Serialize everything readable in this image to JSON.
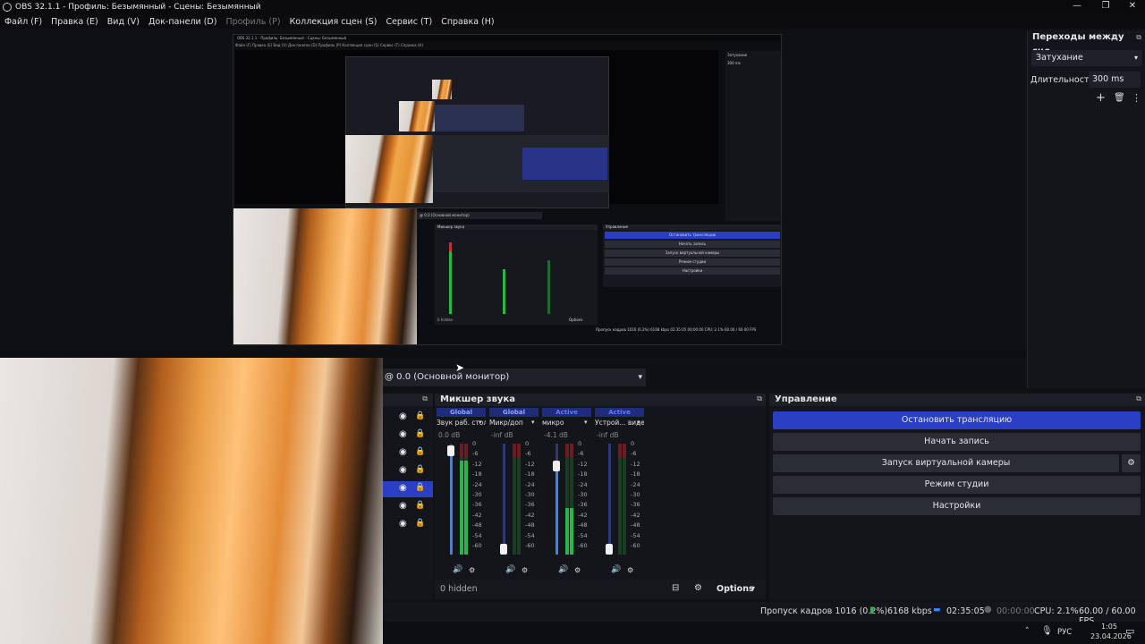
{
  "window": {
    "title": "OBS 32.1.1 - Профиль: Безымянный - Сцены: Безымянный",
    "controls": [
      "—",
      "❐",
      "✕"
    ]
  },
  "menu": [
    {
      "label": "Файл (F)",
      "disabled": false
    },
    {
      "label": "Правка (E)",
      "disabled": false
    },
    {
      "label": "Вид (V)",
      "disabled": false
    },
    {
      "label": "Док-панели (D)",
      "disabled": false
    },
    {
      "label": "Профиль (P)",
      "disabled": true
    },
    {
      "label": "Коллекция сцен (S)",
      "disabled": false
    },
    {
      "label": "Сервис (T)",
      "disabled": false
    },
    {
      "label": "Справка (H)",
      "disabled": false
    }
  ],
  "transitions": {
    "title": "Переходы между сце...",
    "selected": "Затухание",
    "duration_label": "Длительность",
    "duration_value": "300 ms"
  },
  "monitor": {
    "selected": "@ 0.0 (Основной монитор)"
  },
  "mixer": {
    "title": "Микшер звука",
    "hidden_label": "0 hidden",
    "options_label": "Options",
    "channels": [
      {
        "scope": "Global",
        "name": "Звук раб. стола",
        "db": "0.0 dB",
        "fader": 0.98,
        "level": 0.85
      },
      {
        "scope": "Global",
        "name": "Микр/доп",
        "db": "-inf dB",
        "fader": 0.02,
        "level": 0.0
      },
      {
        "scope": "Active",
        "name": "микро",
        "db": "-4.1 dB",
        "fader": 0.85,
        "level": 0.42
      },
      {
        "scope": "Active",
        "name": "Устрой... видео",
        "db": "-inf dB",
        "fader": 0.02,
        "level": 0.0
      }
    ],
    "scale": [
      "0",
      "-6",
      "-12",
      "-18",
      "-24",
      "-30",
      "-36",
      "-42",
      "-48",
      "-54",
      "-60"
    ]
  },
  "sources": {
    "rows": 7,
    "selected_index": 4
  },
  "controls": {
    "title": "Управление",
    "buttons": [
      {
        "label": "Остановить трансляцию",
        "primary": true
      },
      {
        "label": "Начать запись",
        "primary": false
      },
      {
        "label": "Запуск виртуальной камеры",
        "primary": false
      },
      {
        "label": "Режим студии",
        "primary": false
      },
      {
        "label": "Настройки",
        "primary": false
      }
    ]
  },
  "status": {
    "dropped_frames": "Пропуск кадров 1016 (0.2%)",
    "bitrate": "6168 kbps",
    "stream_time": "02:35:05",
    "record_time": "00:00:00",
    "cpu": "CPU: 2.1%",
    "fps": "60.00 / 60.00 FPS"
  },
  "taskbar": {
    "lang": "РУС",
    "time": "1:05",
    "date": "23.04.2026"
  },
  "nested": {
    "title": "OBS 32.1.1 - Профиль: Безымянный - Сцены: Безымянный",
    "menu": "Файл (F)   Правка (E)   Вид (V)   Док-панели (D)   Профиль (P)   Коллекция сцен (S)   Сервис (T)   Справка (H)",
    "monitor": "@ 0.0 (Основной монитор)",
    "mixer_title": "Микшер звука",
    "controls_title": "Управление",
    "buttons": [
      "Остановить трансляцию",
      "Начать запись",
      "Запуск виртуальной камеры",
      "Режим студии",
      "Настройки"
    ],
    "hidden": "0 hidden",
    "options": "Options",
    "status": "Пропуск кадров 1016 (0.2%)   6168 kbps   02:35:05   00:00:00   CPU: 2.1%   60.00 / 60.00 FPS",
    "transition": "Затухание",
    "duration": "300 ms"
  },
  "colors": {
    "accent": "#2b3fc4",
    "panel": "#1d1f26",
    "meter_green": "#27b84a",
    "meter_red": "#c2303a",
    "fader_blue": "#3b82f6"
  }
}
